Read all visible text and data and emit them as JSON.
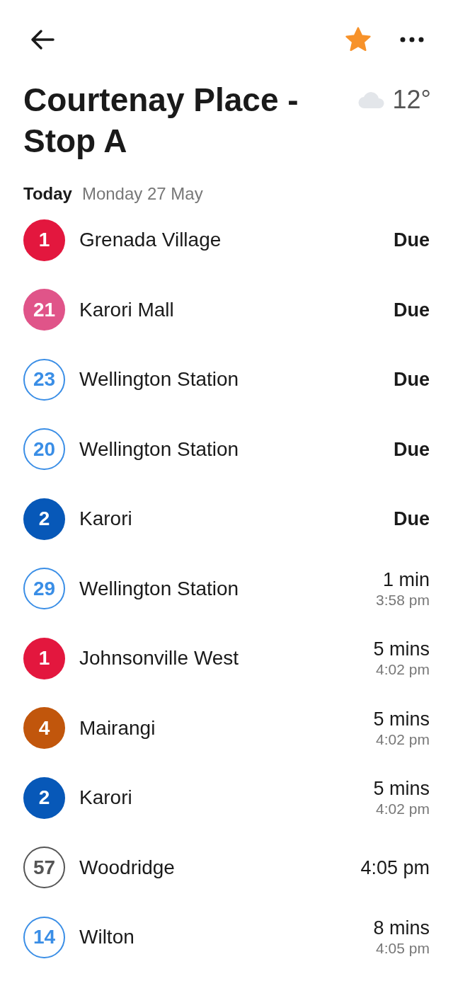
{
  "header": {
    "favorite": true
  },
  "stop": {
    "title": "Courtenay Place - Stop A",
    "temperature": "12°"
  },
  "date": {
    "label": "Today",
    "value": "Monday 27 May"
  },
  "departures": [
    {
      "route": "1",
      "kind": "filled",
      "color": "#e3173e",
      "destination": "Grenada Village",
      "time": "Due",
      "due": true
    },
    {
      "route": "21",
      "kind": "filled",
      "color": "#e05489",
      "destination": "Karori Mall",
      "time": "Due",
      "due": true
    },
    {
      "route": "23",
      "kind": "outline",
      "color": "#3a8ee6",
      "destination": "Wellington Station",
      "time": "Due",
      "due": true
    },
    {
      "route": "20",
      "kind": "outline",
      "color": "#3a8ee6",
      "destination": "Wellington Station",
      "time": "Due",
      "due": true
    },
    {
      "route": "2",
      "kind": "filled",
      "color": "#0758b8",
      "destination": "Karori",
      "time": "Due",
      "due": true
    },
    {
      "route": "29",
      "kind": "outline",
      "color": "#3a8ee6",
      "destination": "Wellington Station",
      "time": "1 min",
      "scheduled": "3:58 pm",
      "due": false
    },
    {
      "route": "1",
      "kind": "filled",
      "color": "#e3173e",
      "destination": "Johnsonville West",
      "time": "5 mins",
      "scheduled": "4:02 pm",
      "due": false
    },
    {
      "route": "4",
      "kind": "filled",
      "color": "#c1560c",
      "destination": "Mairangi",
      "time": "5 mins",
      "scheduled": "4:02 pm",
      "due": false
    },
    {
      "route": "2",
      "kind": "filled",
      "color": "#0758b8",
      "destination": "Karori",
      "time": "5 mins",
      "scheduled": "4:02 pm",
      "due": false
    },
    {
      "route": "57",
      "kind": "outline",
      "color": "#555555",
      "destination": "Woodridge",
      "time": "4:05 pm",
      "due": false
    },
    {
      "route": "14",
      "kind": "outline",
      "color": "#3a8ee6",
      "destination": "Wilton",
      "time": "8 mins",
      "scheduled": "4:05 pm",
      "due": false
    }
  ]
}
